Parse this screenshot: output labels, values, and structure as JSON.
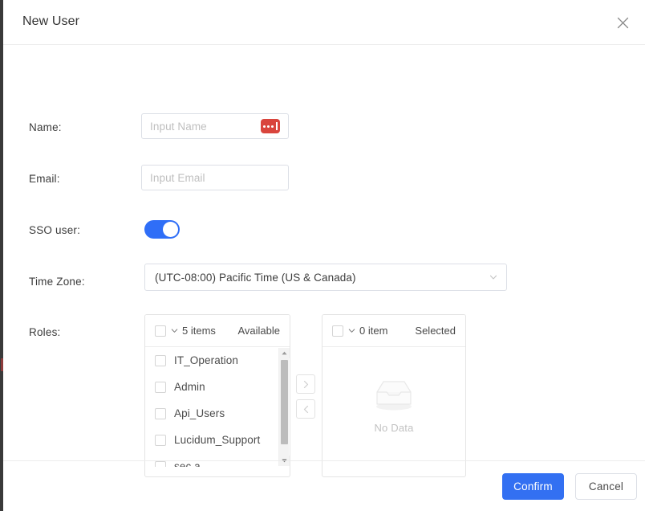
{
  "dialog": {
    "title": "New User",
    "close_icon": "close-icon"
  },
  "form": {
    "name": {
      "label": "Name:",
      "placeholder": "Input Name",
      "value": "",
      "badge_icon": "masked-input-icon",
      "badge_color": "#d9453d"
    },
    "email": {
      "label": "Email:",
      "placeholder": "Input Email",
      "value": ""
    },
    "sso": {
      "label": "SSO user:",
      "state": "on",
      "accent": "#2f6ef7"
    },
    "timezone": {
      "label": "Time Zone:",
      "value": "(UTC-08:00) Pacific Time (US & Canada)",
      "chevron_icon": "chevron-down-icon"
    },
    "roles": {
      "label": "Roles:",
      "available": {
        "count_text": "5 items",
        "side_label": "Available",
        "items": [
          {
            "label": "IT_Operation",
            "checked": false
          },
          {
            "label": "Admin",
            "checked": false
          },
          {
            "label": "Api_Users",
            "checked": false
          },
          {
            "label": "Lucidum_Support",
            "checked": false
          },
          {
            "label": "sec a",
            "checked": false
          }
        ]
      },
      "selected": {
        "count_text": "0 item",
        "side_label": "Selected",
        "empty_text": "No Data",
        "empty_icon": "empty-box-icon",
        "items": []
      },
      "move_right_label": "›",
      "move_left_label": "‹"
    }
  },
  "footer": {
    "confirm_label": "Confirm",
    "cancel_label": "Cancel",
    "primary_color": "#3370f2"
  }
}
